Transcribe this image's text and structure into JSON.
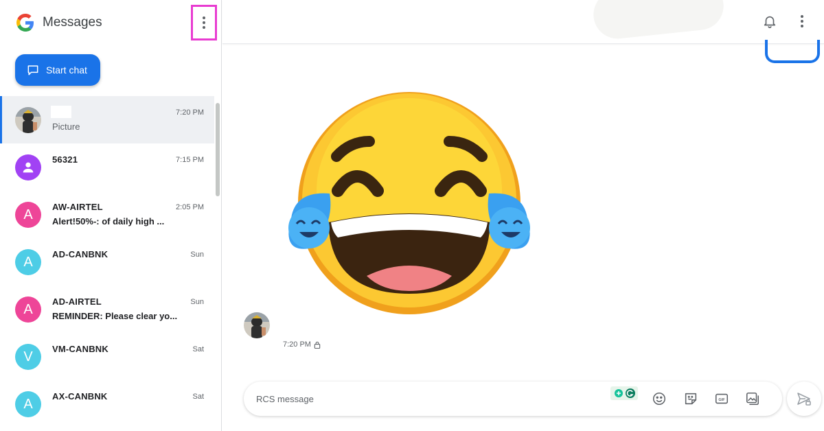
{
  "app": {
    "title": "Messages"
  },
  "sidebar": {
    "start_chat_label": "Start chat",
    "conversations": [
      {
        "name": "",
        "preview": "Picture",
        "time": "7:20 PM",
        "avatar_type": "photo",
        "selected": true
      },
      {
        "name": "56321",
        "preview": "",
        "time": "7:15 PM",
        "avatar_type": "person-icon",
        "avatar_color": "#a142f4"
      },
      {
        "name": "AW-AIRTEL",
        "preview": "Alert!50%-: of daily high ...",
        "time": "2:05 PM",
        "avatar_letter": "A",
        "avatar_color": "#ee4598"
      },
      {
        "name": "AD-CANBNK",
        "preview": "",
        "time": "Sun",
        "avatar_letter": "A",
        "avatar_color": "#4ecde6"
      },
      {
        "name": "AD-AIRTEL",
        "preview": "REMINDER: Please clear yo...",
        "time": "Sun",
        "avatar_letter": "A",
        "avatar_color": "#ee4598"
      },
      {
        "name": "VM-CANBNK",
        "preview": "",
        "time": "Sat",
        "avatar_letter": "V",
        "avatar_color": "#4ecde6"
      },
      {
        "name": "AX-CANBNK",
        "preview": "",
        "time": "Sat",
        "avatar_letter": "A",
        "avatar_color": "#4ecde6"
      }
    ]
  },
  "conversation": {
    "message_time": "7:20 PM",
    "composer_placeholder": "RCS message"
  },
  "icons": {
    "app_logo": "google-g-logo",
    "menu": "more-vertical-icon",
    "notifications": "bell-icon",
    "composer": [
      "emoji-icon",
      "sticker-icon",
      "gif-icon",
      "attach-media-icon"
    ],
    "send": "send-icon"
  },
  "colors": {
    "accent": "#1a73e8",
    "highlight_box": "#e83bd1"
  }
}
